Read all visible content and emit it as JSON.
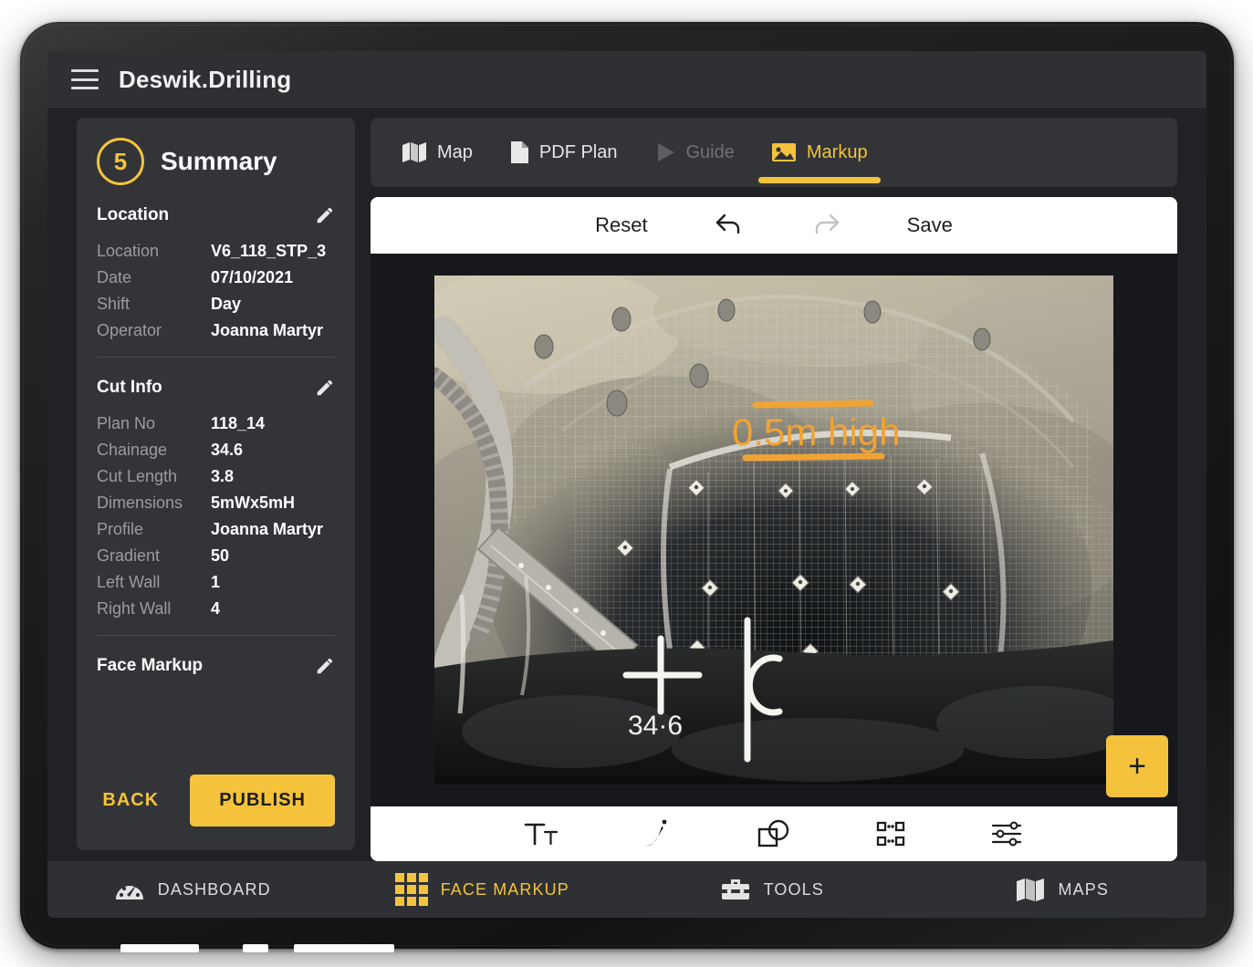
{
  "app": {
    "title": "Deswik.Drilling",
    "menu_icon": "hamburger-icon"
  },
  "sidebar": {
    "step_number": "5",
    "step_title": "Summary",
    "sections": [
      {
        "title": "Location",
        "edit_icon": "pencil-icon",
        "rows": [
          {
            "label": "Location",
            "value": "V6_118_STP_3"
          },
          {
            "label": "Date",
            "value": "07/10/2021"
          },
          {
            "label": "Shift",
            "value": "Day"
          },
          {
            "label": "Operator",
            "value": "Joanna Martyr"
          }
        ]
      },
      {
        "title": "Cut Info",
        "edit_icon": "pencil-icon",
        "rows": [
          {
            "label": "Plan No",
            "value": "118_14"
          },
          {
            "label": "Chainage",
            "value": "34.6"
          },
          {
            "label": "Cut Length",
            "value": "3.8"
          },
          {
            "label": "Dimensions",
            "value": "5mWx5mH"
          },
          {
            "label": "Profile",
            "value": "Joanna Martyr"
          },
          {
            "label": "Gradient",
            "value": "50"
          },
          {
            "label": "Left Wall",
            "value": "1"
          },
          {
            "label": "Right Wall",
            "value": "4"
          }
        ]
      },
      {
        "title": "Face Markup",
        "edit_icon": "pencil-icon",
        "rows": []
      }
    ],
    "back_label": "BACK",
    "publish_label": "PUBLISH"
  },
  "tabs": [
    {
      "label": "Map",
      "icon": "map-icon",
      "state": "normal"
    },
    {
      "label": "PDF Plan",
      "icon": "document-icon",
      "state": "normal"
    },
    {
      "label": "Guide",
      "icon": "play-triangle-icon",
      "state": "disabled"
    },
    {
      "label": "Markup",
      "icon": "image-icon",
      "state": "active"
    }
  ],
  "edit_toolbar": {
    "reset_label": "Reset",
    "undo_icon": "undo-arrow-icon",
    "redo_icon": "redo-arrow-icon",
    "save_label": "Save"
  },
  "canvas": {
    "add_button_label": "+",
    "annotations": [
      {
        "type": "text",
        "value": "0.5m high",
        "color": "#f0a335"
      },
      {
        "type": "line",
        "name": "top-measure-line",
        "color": "#f0a335"
      },
      {
        "type": "line",
        "name": "bottom-measure-line",
        "color": "#f0a335"
      }
    ],
    "photo_chalk_marks": [
      {
        "value": "34·6"
      },
      {
        "value": "℄"
      }
    ]
  },
  "tool_toolbar": [
    {
      "name": "text-tool",
      "icon": "text-tt-icon"
    },
    {
      "name": "draw-tool",
      "icon": "pen-icon"
    },
    {
      "name": "shapes-tool",
      "icon": "shapes-icon"
    },
    {
      "name": "select-tool",
      "icon": "selection-handles-icon"
    },
    {
      "name": "settings-tool",
      "icon": "sliders-icon"
    }
  ],
  "bottom_nav": [
    {
      "label": "DASHBOARD",
      "icon": "gauge-icon",
      "state": "normal"
    },
    {
      "label": "FACE MARKUP",
      "icon": "grid-icon",
      "state": "active"
    },
    {
      "label": "TOOLS",
      "icon": "toolbox-icon",
      "state": "normal"
    },
    {
      "label": "MAPS",
      "icon": "map-icon",
      "state": "normal"
    }
  ],
  "colors": {
    "accent": "#f5c33b",
    "annotation": "#f0a335",
    "panel": "#323438",
    "header": "#2e3034",
    "background": "#212226"
  }
}
